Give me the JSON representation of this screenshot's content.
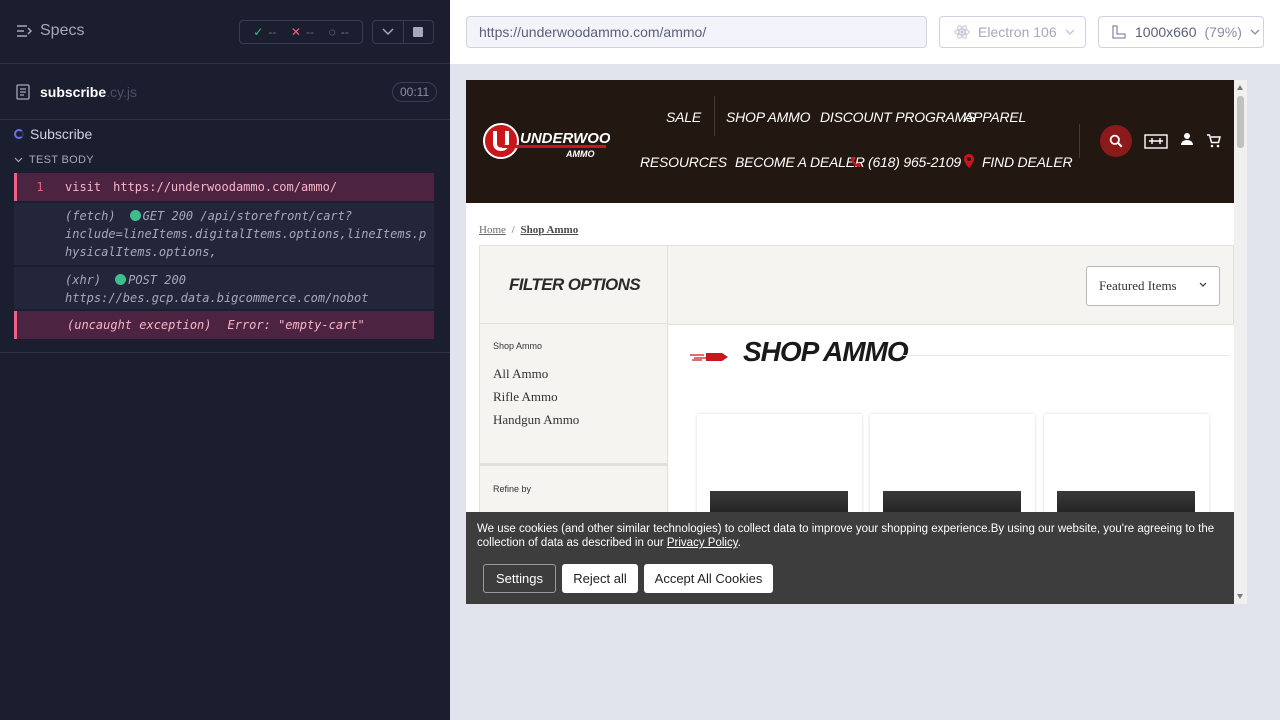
{
  "reporter": {
    "specs_label": "Specs",
    "stats": {
      "passed": "--",
      "failed": "--",
      "pending": "--"
    },
    "file": {
      "name": "subscribe",
      "ext": ".cy.js",
      "duration": "00:11"
    },
    "suite_title": "Subscribe",
    "test_title": "TEST BODY",
    "commands": {
      "visit": {
        "number": "1",
        "name": "visit",
        "message": "https://underwoodammo.com/ammo/"
      },
      "fetch": {
        "type": "(fetch)",
        "line1": "GET 200 /api/storefront/cart?",
        "line2": "include=lineItems.digitalItems.options,lineItems.p",
        "line3": "hysicalItems.options,"
      },
      "xhr": {
        "type": "(xhr)",
        "line1": "POST 200",
        "line2": "https://bes.gcp.data.bigcommerce.com/nobot"
      },
      "error": {
        "type": "(uncaught exception)",
        "message": "Error: \"empty-cart\""
      }
    }
  },
  "aut": {
    "url": "https://underwoodammo.com/ammo/",
    "browser": "Electron 106",
    "viewport": "1000x660",
    "scale": "(79%)"
  },
  "site": {
    "logo": {
      "name": "UNDERWOOD",
      "sub": "AMMO"
    },
    "nav": {
      "sale": "SALE",
      "shop_ammo": "SHOP AMMO",
      "discount_programs": "DISCOUNT PROGRAMS",
      "apparel": "APPAREL",
      "resources": "RESOURCES",
      "become_dealer": "BECOME A DEALER",
      "phone": "(618) 965-2109",
      "find_dealer": "FIND DEALER"
    },
    "breadcrumb": {
      "home": "Home",
      "separator": "/",
      "current": "Shop Ammo"
    },
    "filter_title": "FILTER OPTIONS",
    "sort_selected": "Featured Items",
    "categories": {
      "heading": "Shop Ammo",
      "items": [
        "All Ammo",
        "Rifle Ammo",
        "Handgun Ammo"
      ]
    },
    "refine_heading": "Refine by",
    "page_title": "SHOP AMMO",
    "cookie": {
      "text": "We use cookies (and other similar technologies) to collect data to improve your shopping experience.By using our website, you're agreeing to the collection of data as described in our ",
      "policy_link": "Privacy Policy",
      "period": ".",
      "settings": "Settings",
      "reject": "Reject all",
      "accept": "Accept All Cookies"
    }
  },
  "colors": {
    "reporter_bg": "#1b1e2e",
    "error_bg": "#4c2442",
    "error_accent": "#f1607c",
    "success": "#3dbd8c",
    "header_bg": "#231711",
    "brand_red": "#c8161d"
  }
}
